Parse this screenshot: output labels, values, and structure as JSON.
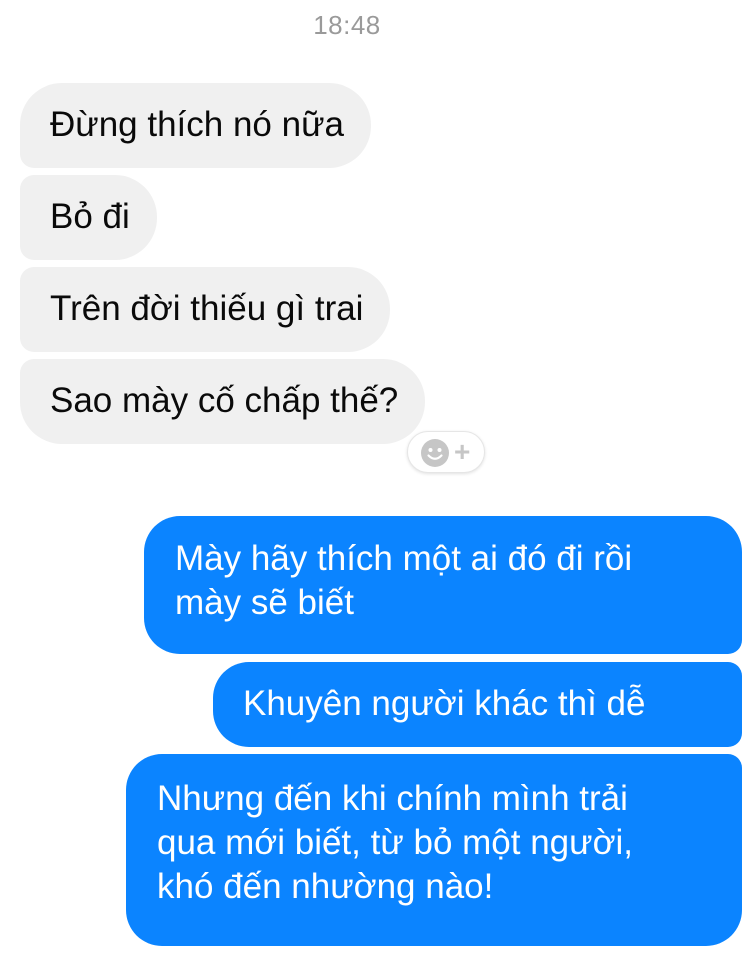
{
  "thread": {
    "timestamp": "18:48",
    "incoming": [
      "Đừng thích nó nữa",
      "Bỏ đi",
      "Trên đời thiếu gì trai",
      "Sao mày cố chấp thế?"
    ],
    "outgoing": [
      [
        "Mày hãy thích một ai đó đi rồi",
        "mày sẽ biết"
      ],
      [
        "Khuyên người khác thì dễ"
      ],
      [
        "Nhưng đến khi chính mình trải",
        "qua mới biết, từ bỏ một người,",
        "khó đến nhường nào!"
      ]
    ]
  },
  "reaction": {
    "icons": [
      "smiley-icon",
      "plus-icon"
    ],
    "plus_glyph": "+"
  },
  "colors": {
    "incoming_bubble": "#f0f0f0",
    "outgoing_bubble": "#0b84ff",
    "outgoing_text": "#ffffff",
    "timestamp_text": "#9a9a9a"
  }
}
